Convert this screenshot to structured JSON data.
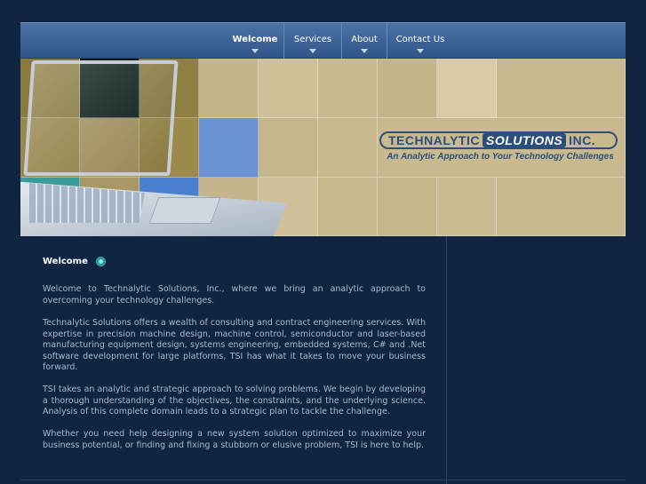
{
  "nav": {
    "items": [
      {
        "label": "Welcome",
        "active": true
      },
      {
        "label": "Services",
        "active": false
      },
      {
        "label": "About",
        "active": false
      },
      {
        "label": "Contact Us",
        "active": false
      }
    ]
  },
  "banner": {
    "logo_part1": "TECHNALYTIC",
    "logo_part2": "SOLUTIONS",
    "logo_part3": "INC.",
    "tagline": "An Analytic Approach to Your Technology Challenges"
  },
  "main": {
    "heading": "Welcome",
    "paragraphs": [
      "Welcome to Technalytic Solutions, Inc., where we bring an analytic approach to overcoming your technology challenges.",
      "Technalytic Solutions offers a wealth of consulting and contract engineering services. With expertise in precision machine design, machine control, semiconductor and laser-based manufacturing equipment design, systems engineering, embedded systems, C# and .Net software development for large platforms, TSI has what it takes to move your business forward.",
      "TSI takes an analytic and strategic approach to solving problems. We begin by developing a thorough understanding of the objectives, the constraints, and the underlying science. Analysis of this complete domain leads to a strategic plan to tackle the challenge.",
      "Whether you need help designing a new system solution optimized to maximize your business potential, or finding and fixing a stubborn or elusive problem, TSI is here to help."
    ]
  },
  "colors": {
    "background": "#0f2542",
    "nav": "#3d6396",
    "banner": "#c9b98f",
    "text": "#a9b8cc",
    "logo": "#2b4f7c"
  }
}
